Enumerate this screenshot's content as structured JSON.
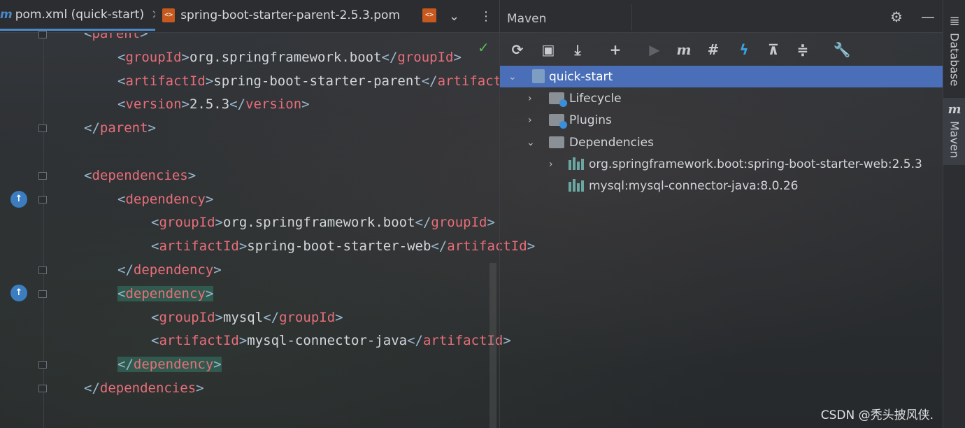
{
  "editor": {
    "tabs": [
      {
        "label": "pom.xml (quick-start)",
        "close": "×",
        "icon": "maven-m-icon"
      },
      {
        "label": "spring-boot-starter-parent-2.5.3.pom",
        "icon": "pom-file-icon"
      }
    ],
    "more_tabs_label": "⌄",
    "menu_label": "⋮",
    "inspection_ok": "✓",
    "lines": [
      {
        "parts": [
          [
            "br",
            "<"
          ],
          [
            "tg",
            "parent"
          ],
          [
            "br",
            ">"
          ]
        ],
        "indent": 0
      },
      {
        "parts": [
          [
            "br",
            "<"
          ],
          [
            "tg",
            "groupId"
          ],
          [
            "br",
            ">"
          ],
          [
            "tx",
            "org.springframework.boot"
          ],
          [
            "br",
            "</"
          ],
          [
            "tg",
            "groupId"
          ],
          [
            "br",
            ">"
          ]
        ],
        "indent": 1
      },
      {
        "parts": [
          [
            "br",
            "<"
          ],
          [
            "tg",
            "artifactId"
          ],
          [
            "br",
            ">"
          ],
          [
            "tx",
            "spring-boot-starter-parent"
          ],
          [
            "br",
            "</"
          ],
          [
            "tg",
            "artifactId"
          ],
          [
            "br",
            ">"
          ]
        ],
        "indent": 1
      },
      {
        "parts": [
          [
            "br",
            "<"
          ],
          [
            "tg",
            "version"
          ],
          [
            "br",
            ">"
          ],
          [
            "tx",
            "2.5.3"
          ],
          [
            "br",
            "</"
          ],
          [
            "tg",
            "version"
          ],
          [
            "br",
            ">"
          ]
        ],
        "indent": 1
      },
      {
        "parts": [
          [
            "br",
            "</"
          ],
          [
            "tg",
            "parent"
          ],
          [
            "br",
            ">"
          ]
        ],
        "indent": 0
      },
      {
        "parts": [],
        "indent": 0
      },
      {
        "parts": [
          [
            "br",
            "<"
          ],
          [
            "tg",
            "dependencies"
          ],
          [
            "br",
            ">"
          ]
        ],
        "indent": 0
      },
      {
        "parts": [
          [
            "br",
            "<"
          ],
          [
            "tg",
            "dependency"
          ],
          [
            "br",
            ">"
          ]
        ],
        "indent": 1
      },
      {
        "parts": [
          [
            "br",
            "<"
          ],
          [
            "tg",
            "groupId"
          ],
          [
            "br",
            ">"
          ],
          [
            "tx",
            "org.springframework.boot"
          ],
          [
            "br",
            "</"
          ],
          [
            "tg",
            "groupId"
          ],
          [
            "br",
            ">"
          ]
        ],
        "indent": 2
      },
      {
        "parts": [
          [
            "br",
            "<"
          ],
          [
            "tg",
            "artifactId"
          ],
          [
            "br",
            ">"
          ],
          [
            "tx",
            "spring-boot-starter-web"
          ],
          [
            "br",
            "</"
          ],
          [
            "tg",
            "artifactId"
          ],
          [
            "br",
            ">"
          ]
        ],
        "indent": 2
      },
      {
        "parts": [
          [
            "br",
            "</"
          ],
          [
            "tg",
            "dependency"
          ],
          [
            "br",
            ">"
          ]
        ],
        "indent": 1
      },
      {
        "parts": [
          [
            "br",
            "<"
          ],
          [
            "tg",
            "dependency"
          ],
          [
            "br",
            ">"
          ]
        ],
        "indent": 1,
        "highlight": true
      },
      {
        "parts": [
          [
            "br",
            "<"
          ],
          [
            "tg",
            "groupId"
          ],
          [
            "br",
            ">"
          ],
          [
            "tx",
            "mysql"
          ],
          [
            "br",
            "</"
          ],
          [
            "tg",
            "groupId"
          ],
          [
            "br",
            ">"
          ]
        ],
        "indent": 2
      },
      {
        "parts": [
          [
            "br",
            "<"
          ],
          [
            "tg",
            "artifactId"
          ],
          [
            "br",
            ">"
          ],
          [
            "tx",
            "mysql-connector-java"
          ],
          [
            "br",
            "</"
          ],
          [
            "tg",
            "artifactId"
          ],
          [
            "br",
            ">"
          ]
        ],
        "indent": 2
      },
      {
        "parts": [
          [
            "br",
            "</"
          ],
          [
            "tg",
            "dependency"
          ],
          [
            "br",
            ">"
          ]
        ],
        "indent": 1,
        "highlight": true
      },
      {
        "parts": [
          [
            "br",
            "</"
          ],
          [
            "tg",
            "dependencies"
          ],
          [
            "br",
            ">"
          ]
        ],
        "indent": 0
      }
    ]
  },
  "maven": {
    "title": "Maven",
    "settings_icon": "gear-icon",
    "hide_icon": "minimize-icon",
    "toolbar": [
      {
        "name": "reload-all-maven-projects-icon",
        "glyph": "⟳"
      },
      {
        "name": "generate-sources-icon",
        "glyph": "▣"
      },
      {
        "name": "download-sources-icon",
        "glyph": "⤓"
      },
      {
        "name": "add-maven-project-icon",
        "glyph": "+"
      },
      {
        "name": "run-maven-build-icon",
        "glyph": "▶",
        "dim": true
      },
      {
        "name": "execute-maven-goal-icon",
        "glyph": "m",
        "style": "m"
      },
      {
        "name": "toggle-offline-mode-icon",
        "glyph": "#"
      },
      {
        "name": "skip-tests-icon",
        "glyph": "ϟ",
        "style": "blue"
      },
      {
        "name": "show-dependencies-icon",
        "glyph": "⊼"
      },
      {
        "name": "collapse-all-icon",
        "glyph": "≑"
      },
      {
        "name": "maven-settings-wrench-icon",
        "glyph": "🔧"
      }
    ],
    "tree": {
      "project": "quick-start",
      "nodes": [
        {
          "label": "Lifecycle",
          "expanded": false
        },
        {
          "label": "Plugins",
          "expanded": false
        },
        {
          "label": "Dependencies",
          "expanded": true
        }
      ],
      "dependencies": [
        {
          "label": "org.springframework.boot:spring-boot-starter-web:2.5.3",
          "expandable": true
        },
        {
          "label": "mysql:mysql-connector-java:8.0.26",
          "expandable": false
        }
      ]
    }
  },
  "side_tabs": [
    {
      "label": "Database",
      "icon": "database-icon"
    },
    {
      "label": "Maven",
      "icon": "maven-m-icon"
    }
  ],
  "watermark": "CSDN @秃头披风侠."
}
